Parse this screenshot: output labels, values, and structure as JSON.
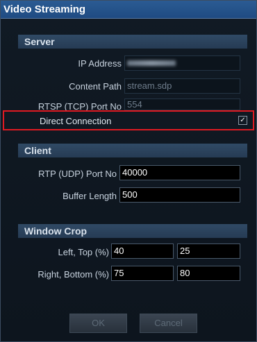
{
  "dialog": {
    "title": "Video Streaming"
  },
  "server": {
    "header": "Server",
    "ip_address_label": "IP Address",
    "content_path_label": "Content Path",
    "content_path_value": "stream.sdp",
    "rtsp_port_label": "RTSP (TCP) Port No",
    "rtsp_port_value": "554",
    "direct_connection_label": "Direct Connection",
    "direct_connection_checked": true,
    "check_mark": "✓"
  },
  "client": {
    "header": "Client",
    "rtp_port_label": "RTP (UDP) Port No",
    "rtp_port_value": "40000",
    "buffer_length_label": "Buffer Length",
    "buffer_length_value": "500"
  },
  "window_crop": {
    "header": "Window Crop",
    "left_top_label": "Left, Top (%)",
    "left_value": "40",
    "top_value": "25",
    "right_bottom_label": "Right, Bottom (%)",
    "right_value": "75",
    "bottom_value": "80"
  },
  "buttons": {
    "ok_label": "OK",
    "cancel_label": "Cancel"
  }
}
